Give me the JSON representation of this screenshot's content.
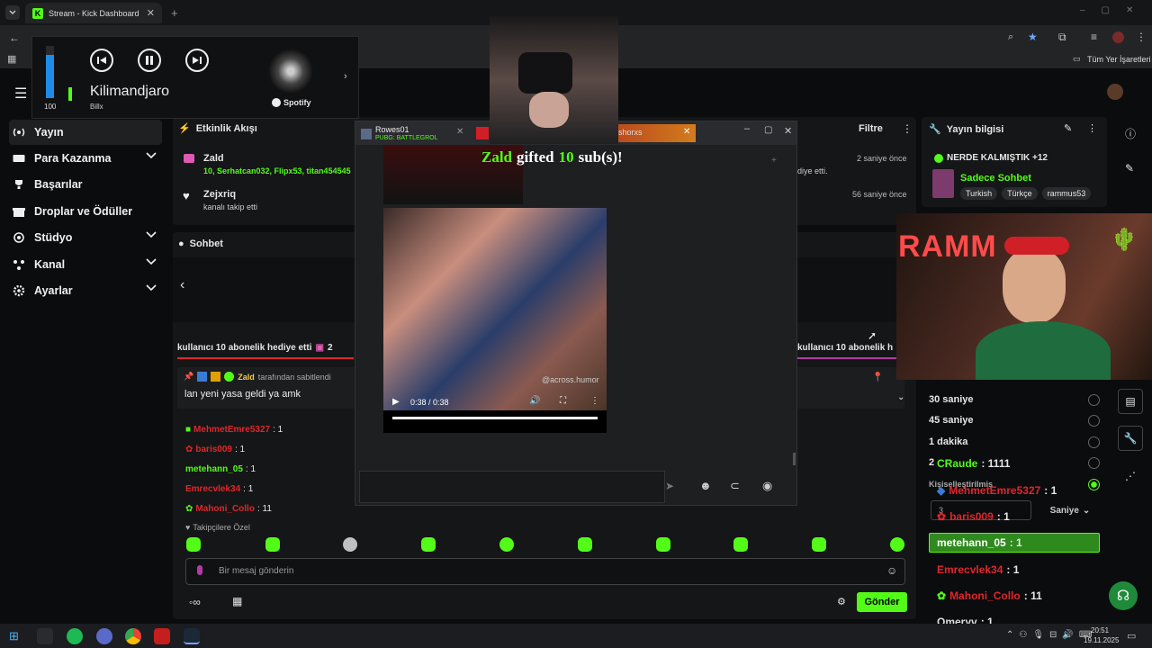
{
  "browser": {
    "tab_title": "Stream - Kick Dashboard",
    "bookmarks_label": "Tüm Yer İşaretleri"
  },
  "spotify": {
    "volume": "100",
    "track": "Kilimandjaro",
    "artist": "Billx",
    "brand": "Spotify"
  },
  "sidebar": {
    "items": [
      {
        "label": "Yayın",
        "icon": "broadcast-icon",
        "active": true
      },
      {
        "label": "Para Kazanma",
        "icon": "money-icon",
        "expand": true
      },
      {
        "label": "Başarılar",
        "icon": "trophy-icon"
      },
      {
        "label": "Droplar ve Ödüller",
        "icon": "gift-icon"
      },
      {
        "label": "Stüdyo",
        "icon": "studio-icon",
        "expand": true
      },
      {
        "label": "Kanal",
        "icon": "channel-icon",
        "expand": true
      },
      {
        "label": "Ayarlar",
        "icon": "gear-icon",
        "expand": true
      }
    ]
  },
  "activity": {
    "title": "Etkinlik Akışı",
    "filter": "Filtre",
    "items": [
      {
        "name": "Zald",
        "detail": "10, Serhatcan032, Flipx53, titan454545",
        "detail_suffix": "diye etti.",
        "time": "2 saniye önce"
      },
      {
        "name": "Zejxriq",
        "detail": "kanalı takip etti",
        "time": "56 saniye önce"
      }
    ]
  },
  "popup": {
    "tab1_name": "Rowes01",
    "tab1_game": "PUBG: BATTLEGROL",
    "tab3_name": "shorxs",
    "gift_name": "Zald",
    "gift_mid": "gifted",
    "gift_count": "10",
    "gift_end": "sub(s)!",
    "video_time": "0:38 / 0:38",
    "watermark": "@across.humor"
  },
  "chat": {
    "title": "Sohbet",
    "banner_left": "kullanıcı 10 abonelik hediye etti",
    "banner_left_num": "2",
    "banner_right": "kullanıcı 10 abonelik h",
    "pinned_by": "Zald",
    "pinned_suffix": "tarafından sabitlendi",
    "pinned_message": "lan yeni yasa geldi ya amk",
    "followers_only": "Takipçilere Özel",
    "placeholder": "Bir mesaj gönderin",
    "send": "Gönder",
    "leaders": [
      {
        "name": "MehmetEmre5327",
        "value": ": 1"
      },
      {
        "name": "baris009",
        "value": ": 1"
      },
      {
        "name": "metehann_05",
        "value": ": 1"
      },
      {
        "name": "Emrecvlek34",
        "value": ": 1"
      },
      {
        "name": "Mahoni_Collo",
        "value": ": 11"
      }
    ]
  },
  "stream_info": {
    "title": "Yayın bilgisi",
    "stream_title": "NERDE KALMIŞTIK +12",
    "category": "Sadece Sohbet",
    "tags": [
      "Turkish",
      "Türkçe",
      "rammus53"
    ],
    "overlay_text": "RAMM"
  },
  "right_panel": {
    "options": [
      "30 saniye",
      "45 saniye",
      "1 dakika",
      "2"
    ],
    "custom_label": "Kişiselleştirilmiş",
    "custom_value": "3",
    "unit": "Saniye",
    "top_name": "CRaude",
    "top_value": ": 1111",
    "leaders": [
      {
        "name": "MehmetEmre5327",
        "value": ": 1"
      },
      {
        "name": "baris009",
        "value": ": 1"
      },
      {
        "name": "metehann_05",
        "value": ": 1"
      },
      {
        "name": "Emrecvlek34",
        "value": ": 1"
      },
      {
        "name": "Mahoni_Collo",
        "value": ": 11"
      },
      {
        "name": "Omeryv",
        "value": ": 1"
      }
    ]
  },
  "taskbar": {
    "time": "20:51",
    "date": "19.11.2025"
  },
  "colors": {
    "accent": "#53fc18",
    "red": "#e0262b",
    "panel": "#151617"
  }
}
